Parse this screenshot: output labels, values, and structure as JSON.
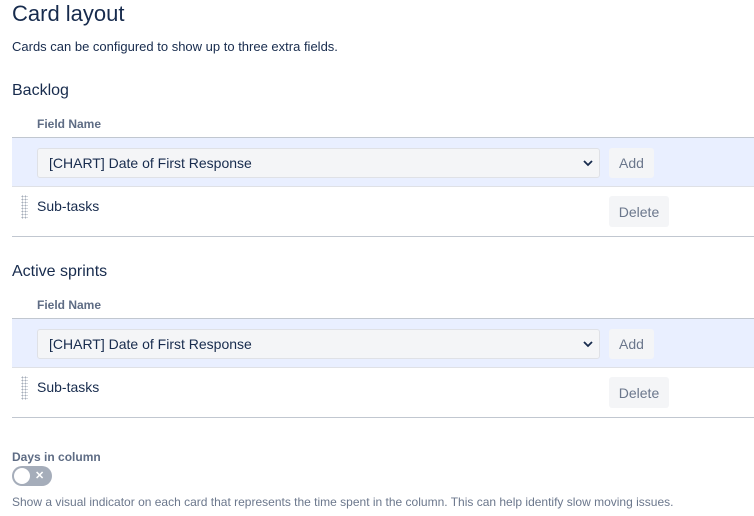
{
  "page": {
    "title": "Card layout",
    "description": "Cards can be configured to show up to three extra fields."
  },
  "sections": {
    "backlog": {
      "title": "Backlog",
      "field_header": "Field Name",
      "select_value": "[CHART] Date of First Response",
      "add_label": "Add",
      "fields": [
        {
          "name": "Sub-tasks",
          "delete_label": "Delete"
        }
      ]
    },
    "active_sprints": {
      "title": "Active sprints",
      "field_header": "Field Name",
      "select_value": "[CHART] Date of First Response",
      "add_label": "Add",
      "fields": [
        {
          "name": "Sub-tasks",
          "delete_label": "Delete"
        }
      ]
    }
  },
  "days_in_column": {
    "label": "Days in column",
    "enabled": false,
    "toggle_icon": "x-icon",
    "description": "Show a visual indicator on each card that represents the time spent in the column. This can help identify slow moving issues."
  },
  "colors": {
    "text": "#172b4d",
    "subtle_text": "#5e6c84",
    "add_row_bg": "#e9efff",
    "button_bg": "#f4f5f7",
    "toggle_off": "#a5adba"
  }
}
